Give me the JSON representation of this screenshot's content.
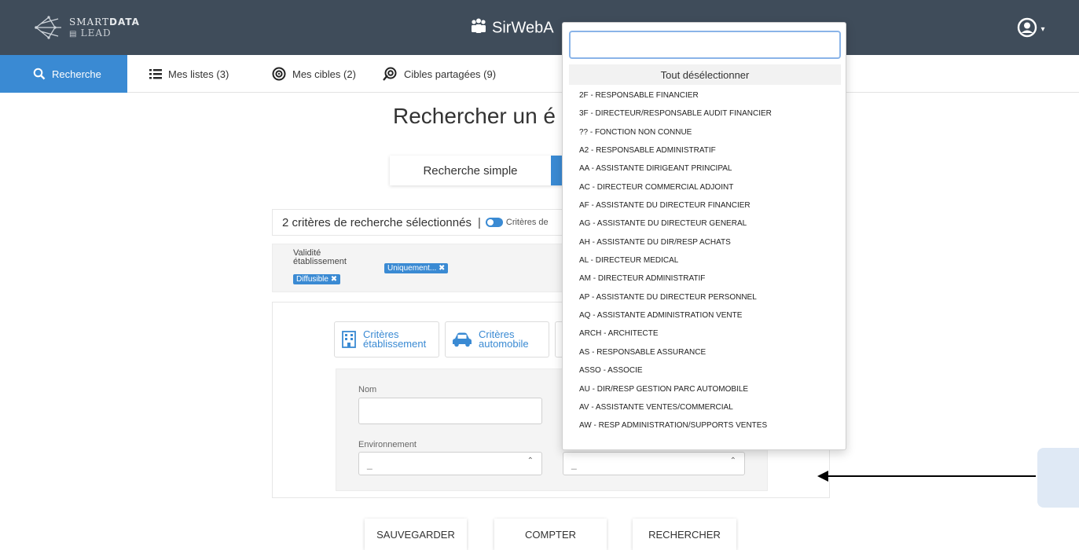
{
  "header": {
    "brand_line1_a": "SMART",
    "brand_line1_b": "DATA",
    "brand_line2": "LEAD",
    "app_title": "SirWebA",
    "user_caret": "▾"
  },
  "tabs": [
    {
      "label": "Recherche",
      "icon": "search-icon"
    },
    {
      "label": "Mes listes (3)",
      "icon": "list-icon"
    },
    {
      "label": "Mes cibles (2)",
      "icon": "target-icon"
    },
    {
      "label": "Cibles partagées (9)",
      "icon": "shared-target-icon"
    }
  ],
  "main": {
    "heading": "Rechercher un é",
    "mode_simple": "Recherche simple",
    "criteria_count": "2 critères de recherche sélectionnés",
    "criteria_toggle_label": "Critères de",
    "filter": {
      "label_line1": "Validité",
      "label_line2": "établissement",
      "tag1": "Diffusible ✖",
      "tag2": "Uniquement... ✖"
    },
    "criteria_tabs": [
      {
        "line1": "Critères",
        "line2": "établissement",
        "icon": "building-icon"
      },
      {
        "line1": "Critères",
        "line2": "automobile",
        "icon": "car-icon"
      }
    ],
    "form": {
      "nom_label": "Nom",
      "env_label": "Environnement",
      "env_value": "_",
      "second_select_value": "_"
    },
    "buttons": {
      "save": "SAUVEGARDER",
      "count": "COMPTER",
      "search": "RECHERCHER"
    }
  },
  "dropdown": {
    "search_value": "",
    "deselect_all": "Tout désélectionner",
    "options": [
      "2F - RESPONSABLE FINANCIER",
      "3F - DIRECTEUR/RESPONSABLE AUDIT FINANCIER",
      "?? - FONCTION NON CONNUE",
      "A2 - RESPONSABLE ADMINISTRATIF",
      "AA - ASSISTANTE DIRIGEANT PRINCIPAL",
      "AC - DIRECTEUR COMMERCIAL ADJOINT",
      "AF - ASSISTANTE DU DIRECTEUR FINANCIER",
      "AG - ASSISTANTE DU DIRECTEUR GENERAL",
      "AH - ASSISTANTE DU DIR/RESP ACHATS",
      "AL - DIRECTEUR MEDICAL",
      "AM - DIRECTEUR ADMINISTRATIF",
      "AP - ASSISTANTE DU DIRECTEUR PERSONNEL",
      "AQ - ASSISTANTE ADMINISTRATION VENTE",
      "ARCH - ARCHITECTE",
      "AS - RESPONSABLE ASSURANCE",
      "ASSO - ASSOCIE",
      "AU - DIR/RESP GESTION PARC AUTOMOBILE",
      "AV - ASSISTANTE VENTES/COMMERCIAL",
      "AW - RESP ADMINISTRATION/SUPPORTS VENTES"
    ]
  },
  "colors": {
    "header_bg": "#3f4c5a",
    "accent": "#3a8ad3"
  }
}
